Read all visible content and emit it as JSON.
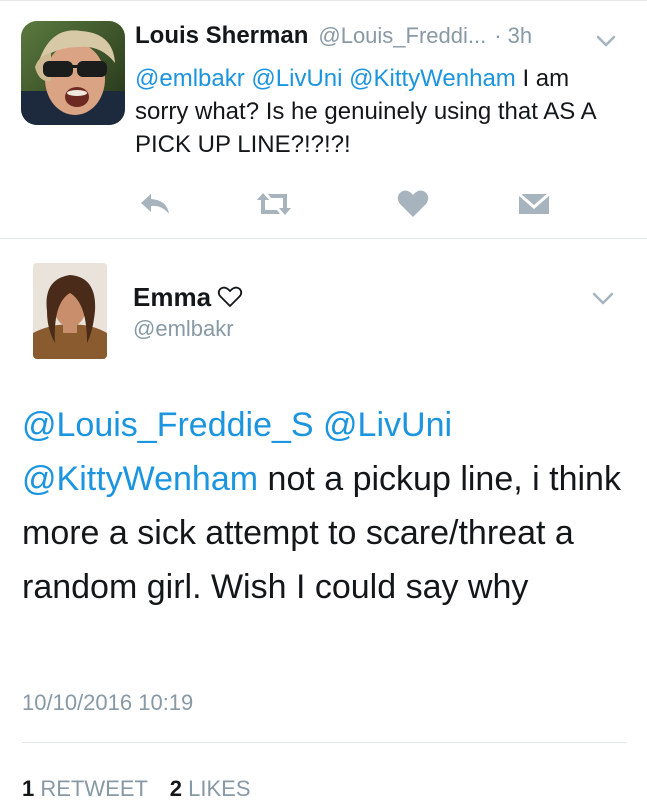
{
  "tweet1": {
    "author_name": "Louis Sherman",
    "handle": "@Louis_Freddi...",
    "time": "· 3h",
    "mentions": [
      "@emlbakr",
      "@LivUni",
      "@KittyWenham"
    ],
    "text_before_break": "I",
    "text_rest": "am sorry what? Is he genuinely using that AS A PICK UP LINE?!?!?!",
    "actions": [
      "reply-icon",
      "retweet-icon",
      "like-icon",
      "direct-message-icon"
    ],
    "colors": {
      "action_icon": "#a7b3bd",
      "text": "#14171a"
    }
  },
  "tweet2": {
    "author_name": "Emma",
    "name_emoji": "heart-outline-icon",
    "handle": "@emlbakr",
    "mentions": [
      "@Louis_Freddie_S",
      "@LivUni",
      "@KittyWenham"
    ],
    "text": "not a pickup line, i think more a sick attempt to scare/threat a random girl. Wish I could say why",
    "date": "10/10/2016 10:19",
    "retweet_count": "1",
    "retweet_label": "RETWEET",
    "like_count": "2",
    "like_label": "LIKES"
  },
  "colors": {
    "link": "#1b95e0",
    "meta": "#8899a6",
    "divider": "#e1e8ed",
    "text": "#14171a"
  }
}
